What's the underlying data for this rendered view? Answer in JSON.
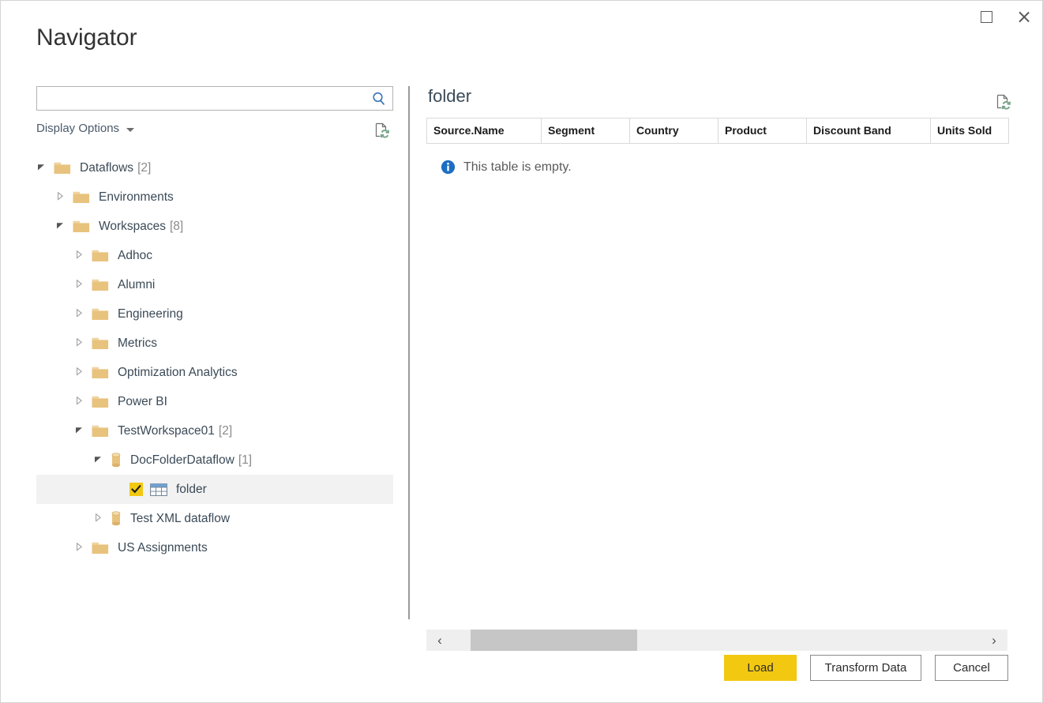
{
  "window": {
    "title": "Navigator",
    "maximize_icon": "maximize-square-icon",
    "close_icon": "close-x-icon"
  },
  "left_pane": {
    "search": {
      "value": "",
      "placeholder": "",
      "icon": "search-magnifier-icon"
    },
    "display_options": {
      "label": "Display Options",
      "caret_icon": "chevron-down-icon"
    },
    "refresh_icon": "refresh-page-icon",
    "tree": [
      {
        "label": "Dataflows",
        "count": "[2]",
        "icon": "folder-icon",
        "state": "expanded",
        "depth": 0,
        "checkbox": false,
        "selected": false
      },
      {
        "label": "Environments",
        "count": "",
        "icon": "folder-icon",
        "state": "collapsed",
        "depth": 1,
        "checkbox": false,
        "selected": false
      },
      {
        "label": "Workspaces",
        "count": "[8]",
        "icon": "folder-icon",
        "state": "expanded",
        "depth": 1,
        "checkbox": false,
        "selected": false
      },
      {
        "label": "Adhoc",
        "count": "",
        "icon": "folder-icon",
        "state": "collapsed",
        "depth": 2,
        "checkbox": false,
        "selected": false
      },
      {
        "label": "Alumni",
        "count": "",
        "icon": "folder-icon",
        "state": "collapsed",
        "depth": 2,
        "checkbox": false,
        "selected": false
      },
      {
        "label": "Engineering",
        "count": "",
        "icon": "folder-icon",
        "state": "collapsed",
        "depth": 2,
        "checkbox": false,
        "selected": false
      },
      {
        "label": "Metrics",
        "count": "",
        "icon": "folder-icon",
        "state": "collapsed",
        "depth": 2,
        "checkbox": false,
        "selected": false
      },
      {
        "label": "Optimization Analytics",
        "count": "",
        "icon": "folder-icon",
        "state": "collapsed",
        "depth": 2,
        "checkbox": false,
        "selected": false
      },
      {
        "label": "Power BI",
        "count": "",
        "icon": "folder-icon",
        "state": "collapsed",
        "depth": 2,
        "checkbox": false,
        "selected": false
      },
      {
        "label": "TestWorkspace01",
        "count": "[2]",
        "icon": "folder-icon",
        "state": "expanded",
        "depth": 2,
        "checkbox": false,
        "selected": false
      },
      {
        "label": "DocFolderDataflow",
        "count": "[1]",
        "icon": "dataflow-cylinder-icon",
        "state": "expanded",
        "depth": 3,
        "checkbox": false,
        "selected": false
      },
      {
        "label": "folder",
        "count": "",
        "icon": "table-icon",
        "state": "leaf",
        "depth": 4,
        "checkbox": true,
        "checked": true,
        "selected": true
      },
      {
        "label": "Test XML dataflow",
        "count": "",
        "icon": "dataflow-cylinder-icon",
        "state": "collapsed",
        "depth": 3,
        "checkbox": false,
        "selected": false
      },
      {
        "label": "US Assignments",
        "count": "",
        "icon": "folder-icon",
        "state": "collapsed",
        "depth": 2,
        "checkbox": false,
        "selected": false
      }
    ]
  },
  "right_pane": {
    "title": "folder",
    "refresh_icon": "refresh-page-icon",
    "columns": [
      "Source.Name",
      "Segment",
      "Country",
      "Product",
      "Discount Band",
      "Units Sold"
    ],
    "rows": [],
    "empty_message": "This table is empty.",
    "empty_icon": "info-circle-icon",
    "scrollbar": {
      "left_arrow": "‹",
      "right_arrow": "›"
    }
  },
  "footer": {
    "load_label": "Load",
    "transform_label": "Transform Data",
    "cancel_label": "Cancel"
  },
  "colors": {
    "accent_yellow": "#F2C811",
    "folder_tan": "#E8C37E",
    "info_blue": "#1B6EC2",
    "refresh_green": "#7AA78C",
    "selected_row": "#F2F2F2",
    "text_primary": "#3B4A57"
  }
}
